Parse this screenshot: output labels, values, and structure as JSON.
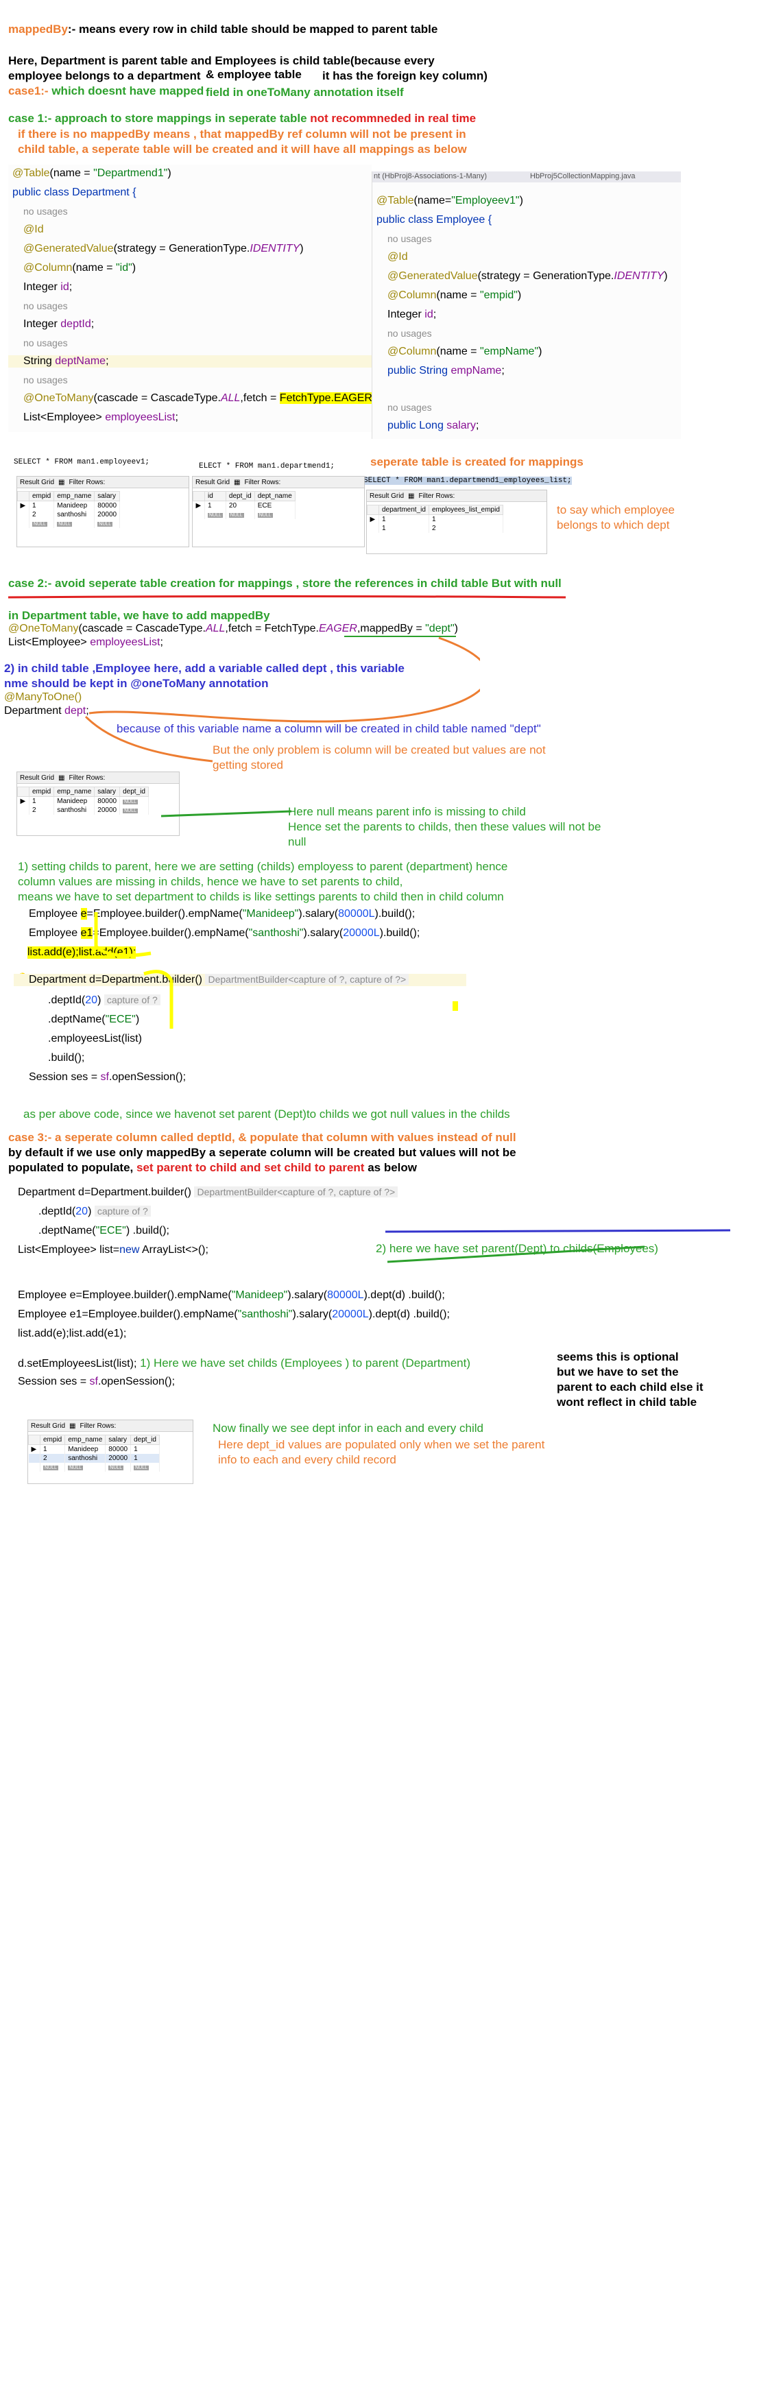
{
  "intro": {
    "mappedby_term": "mappedBy",
    "mappedby_def": ":- means every row in child table should be mapped to parent table",
    "line2": "Here, Department is parent table and Employees is child table(because every",
    "line3a": "employee belongs to a department",
    "line3b": "& employee table",
    "line3c": "it has the foreign key column)",
    "case1_prefix": "case1:-",
    "case1_text": " which doesnt have mapped",
    "case1_text2": "field in oneToMany annotation itself"
  },
  "case1": {
    "title": "case 1:- approach to store mappings in seperate table",
    "title_red": " not recommneded in real time",
    "desc1": "if there is no mappedBy means , that mappedBy ref column will not be present in",
    "desc2": "child table, a seperate table will be created and it will have all mappings as below",
    "dept_code": {
      "l1_ann": "@Table",
      "l1_rest": "(name = ",
      "l1_str": "\"Departmend1\"",
      "l1_end": ")",
      "l2": "public class Department {",
      "usage1": "no usages",
      "l3": "@Id",
      "l4_ann": "@GeneratedValue",
      "l4_rest": "(strategy = GenerationType.",
      "l4_ita": "IDENTITY",
      "l4_end": ")",
      "l5_ann": "@Column",
      "l5_rest": "(name = ",
      "l5_str": "\"id\"",
      "l5_end": ")",
      "l6a": "Integer ",
      "l6b": "id",
      "l6c": ";",
      "usage2": "no usages",
      "l7a": "Integer ",
      "l7b": "deptId",
      "l7c": ";",
      "usage3": "no usages",
      "l8a": "String ",
      "l8b": "deptName",
      "l8c": ";",
      "usage4": "no usages",
      "l9_ann": "@OneToMany",
      "l9_rest": "(cascade = CascadeType.",
      "l9_ita": "ALL",
      "l9_mid": ",fetch = ",
      "l9_hl": "FetchType.EAGER",
      "l9_end": ")",
      "l10a": "List<Employee> ",
      "l10b": "employeesList",
      "l10c": ";"
    },
    "emp_code": {
      "tab": "nt (HbProj8-Associations-1-Many)",
      "tab2": "HbProj5CollectionMapping.java",
      "l1_ann": "@Table",
      "l1_rest": "(name=",
      "l1_str": "\"Employeev1\"",
      "l1_end": ")",
      "l2": "public class Employee {",
      "usage1": "no usages",
      "l3": "@Id",
      "l4_ann": "@GeneratedValue",
      "l4_rest": "(strategy = GenerationType.",
      "l4_ita": "IDENTITY",
      "l4_end": ")",
      "l5_ann": "@Column",
      "l5_rest": "(name = ",
      "l5_str": "\"empid\"",
      "l5_end": ")",
      "l6a": "Integer ",
      "l6b": "id",
      "l6c": ";",
      "usage2": "no usages",
      "l7_ann": "@Column",
      "l7_rest": "(name = ",
      "l7_str": "\"empName\"",
      "l7_end": ")",
      "l8a": "public String ",
      "l8b": "empName",
      "l8c": ";",
      "usage3": "no usages",
      "l9a": "public Long ",
      "l9b": "salary",
      "l9c": ";"
    },
    "sql1": "SELECT * FROM man1.employeev1;",
    "sql2": "ELECT * FROM man1.departmend1;",
    "sql3": "SELECT * FROM man1.departmend1_employees_list;",
    "mapping_note": "seperate table is created for mappings",
    "side_note1": "to say which employee",
    "side_note2": "belongs to which dept",
    "grid1": {
      "cols": [
        "empid",
        "emp_name",
        "salary"
      ],
      "rows": [
        [
          "1",
          "Manideep",
          "80000"
        ],
        [
          "2",
          "santhoshi",
          "20000"
        ]
      ]
    },
    "grid2": {
      "cols": [
        "id",
        "dept_id",
        "dept_name"
      ],
      "rows": [
        [
          "1",
          "20",
          "ECE"
        ]
      ]
    },
    "grid3": {
      "cols": [
        "department_id",
        "employees_list_empid"
      ],
      "rows": [
        [
          "1",
          "1"
        ],
        [
          "1",
          "2"
        ]
      ]
    }
  },
  "grid_ui": {
    "result_grid": "Result Grid",
    "filter_rows": "Filter Rows:",
    "null": "NULL"
  },
  "case2": {
    "title": "case 2:- avoid seperate table creation for mappings , store the references in child table",
    "title_suffix": " But with null",
    "p1": "in Department table, we have to add mappedBy",
    "code1_ann": "@OneToMany",
    "code1_rest": "(cascade = CascadeType.",
    "code1_ita": "ALL",
    "code1_mid": ",fetch = FetchType.",
    "code1_ita2": "EAGER",
    "code1_mid2": ",mappedBy = ",
    "code1_str": "\"dept\"",
    "code1_end": ")",
    "code2a": "List<Employee> ",
    "code2b": "employeesList",
    "code2c": ";",
    "p2a": "2) in child table ,Employee here, add a variable called dept , this variable",
    "p2b": "nme should",
    "p2c": " be kept in @oneToMany annotation",
    "code3": "@ManyToOne()",
    "code4a": "Department ",
    "code4b": "dept",
    "code4c": ";",
    "note_blue": "because of this variable name a column will be created in child table named \"dept\"",
    "note_orange1": "But the only problem is column will be created but values are not",
    "note_orange2": "getting stored",
    "grid": {
      "cols": [
        "empid",
        "emp_name",
        "salary",
        "dept_id"
      ],
      "rows": [
        [
          "1",
          "Manideep",
          "80000",
          "NULL"
        ],
        [
          "2",
          "santhoshi",
          "20000",
          "NULL"
        ]
      ]
    },
    "null_note1": "Here null means parent info is missing to child",
    "null_note2": "Hence set the parents to childs, then these values will not be",
    "null_note3": "null",
    "setting1": "1) setting childs to parent, here we are setting (childs) employess to parent (department) hence",
    "setting2": "column values are missing in childs, hence we have to set parents to child,",
    "setting3": "means we have to set department to childs is like settings parents to child then in child column",
    "code_a1": "Employee ",
    "code_a2": "e",
    "code_a3": "=Employee.builder().empName(",
    "code_a4": "\"Manideep\"",
    "code_a5": ").salary(",
    "code_a6": "80000L",
    "code_a7": ").build();",
    "code_b1": "Employee ",
    "code_b2": "e1",
    "code_b3": "=Employee.builder().empName(",
    "code_b4": "\"santhoshi\"",
    "code_b5": ").salary(",
    "code_b6": "20000L",
    "code_b7": ").build();",
    "code_c": "list.add(e);list.add(e1);",
    "code_d1": "Department d=Department.builder()",
    "code_d2": "DepartmentBuilder<capture of ?, capture of ?>",
    "code_e1": ".deptId(",
    "code_e2": "20",
    "code_e3": ")",
    "code_e4": "capture of ?",
    "code_f1": ".deptName(",
    "code_f2": "\"ECE\"",
    "code_f3": ")",
    "code_g": ".employeesList(list)",
    "code_h": ".build();",
    "code_i1": "Session ses = ",
    "code_i2": "sf",
    "code_i3": ".openSession();",
    "conclusion": "as per above code, since we havenot set parent (Dept)to childs we got null values in the childs"
  },
  "case3": {
    "title": "case 3:- a seperate column called deptId, & populate that column with values instead of null",
    "line2": "by default if we use only mappedBy a seperate column will be created but values will not be",
    "line3a": "populated to populate, ",
    "line3b": "set parent to child and set child to parent",
    "line3c": " as below",
    "c1a": "Department d=Department.builder()",
    "c1b": "DepartmentBuilder<capture of ?, capture of ?>",
    "c2a": ".deptId(",
    "c2b": "20",
    "c2c": ")",
    "c2d": "capture of ?",
    "c3a": ".deptName(",
    "c3b": "\"ECE\"",
    "c3c": ") .build();",
    "c4a": "List<Employee> list=",
    "c4b": "new",
    "c4c": " ArrayList<>();",
    "note_green2": "2) here we have set parent(Dept) to childs(Employees)",
    "c5a": "Employee e=Employee.builder().empName(",
    "c5b": "\"Manideep\"",
    "c5c": ").salary(",
    "c5d": "80000L",
    "c5e": ").dept(d) .build();",
    "c6a": "Employee e1=Employee.builder().empName(",
    "c6b": "\"santhoshi\"",
    "c6c": ").salary(",
    "c6d": "20000L",
    "c6e": ").dept(d) .build();",
    "c7": "list.add(e);list.add(e1);",
    "c8a": "d.setEmployeesList(list);",
    "c8b": " 1) Here we have set childs (Employees ) to parent (Department)",
    "c9a": "Session ses = ",
    "c9b": "sf",
    "c9c": ".openSession();",
    "optional1": "seems this is optional",
    "optional2": "but we have to set the",
    "optional3": "parent to each child else it",
    "optional4": "wont reflect in child table",
    "final_green": "Now finally we see dept infor in each and every child",
    "final_orange1": "Here dept_id values are populated only when we set the parent",
    "final_orange2": "info to each and every child record",
    "grid": {
      "cols": [
        "empid",
        "emp_name",
        "salary",
        "dept_id"
      ],
      "rows": [
        [
          "1",
          "Manideep",
          "80000",
          "1"
        ],
        [
          "2",
          "santhoshi",
          "20000",
          "1"
        ]
      ]
    }
  }
}
